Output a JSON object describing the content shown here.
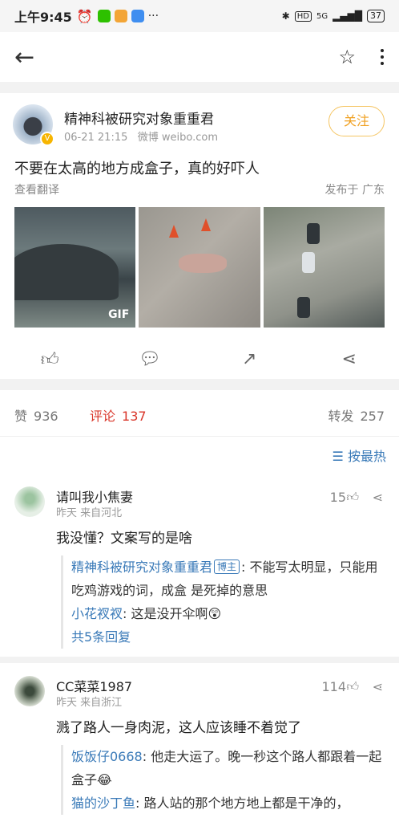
{
  "status_bar": {
    "time": "上午9:45",
    "network": "5G",
    "hd": "HD",
    "battery": "37"
  },
  "header": {
    "back_icon": "arrow-left-icon",
    "star_icon": "star-icon",
    "more_icon": "more-vertical-icon"
  },
  "post": {
    "author": "精神科被研究对象重重君",
    "date": "06-21 21:15",
    "source": "微博 weibo.com",
    "follow_label": "关注",
    "text": "不要在太高的地方成盒子，真的好吓人",
    "translate_label": "查看翻译",
    "location": "发布于 广东",
    "gif_label": "GIF"
  },
  "stats": {
    "likes_label": "赞",
    "likes_count": "936",
    "comments_label": "评论",
    "comments_count": "137",
    "reposts_label": "转发",
    "reposts_count": "257",
    "sort_label": "按最热"
  },
  "comments": [
    {
      "name": "请叫我小焦妻",
      "meta": "昨天  来自河北",
      "likes": "15",
      "text": "我没懂？文案写的是啥",
      "replies": [
        {
          "name": "精神科被研究对象重重君",
          "badge": "博主",
          "text": ": 不能写太明显，只能用吃鸡游戏的词，成盒 是死掉的意思"
        },
        {
          "name": "小花衩衩",
          "text": ": 这是没开伞啊😲"
        }
      ],
      "more": "共5条回复"
    },
    {
      "name": "CC菜菜1987",
      "meta": "昨天  来自浙江",
      "likes": "114",
      "text": "溅了路人一身肉泥，这人应该睡不着觉了",
      "replies": [
        {
          "name": "饭饭仔0668",
          "text": ": 他走大运了。晚一秒这个路人都跟着一起盒子😂"
        },
        {
          "name": "猫的沙丁鱼",
          "text": ": 路人站的那个地方地上都是干净的，"
        }
      ]
    }
  ]
}
